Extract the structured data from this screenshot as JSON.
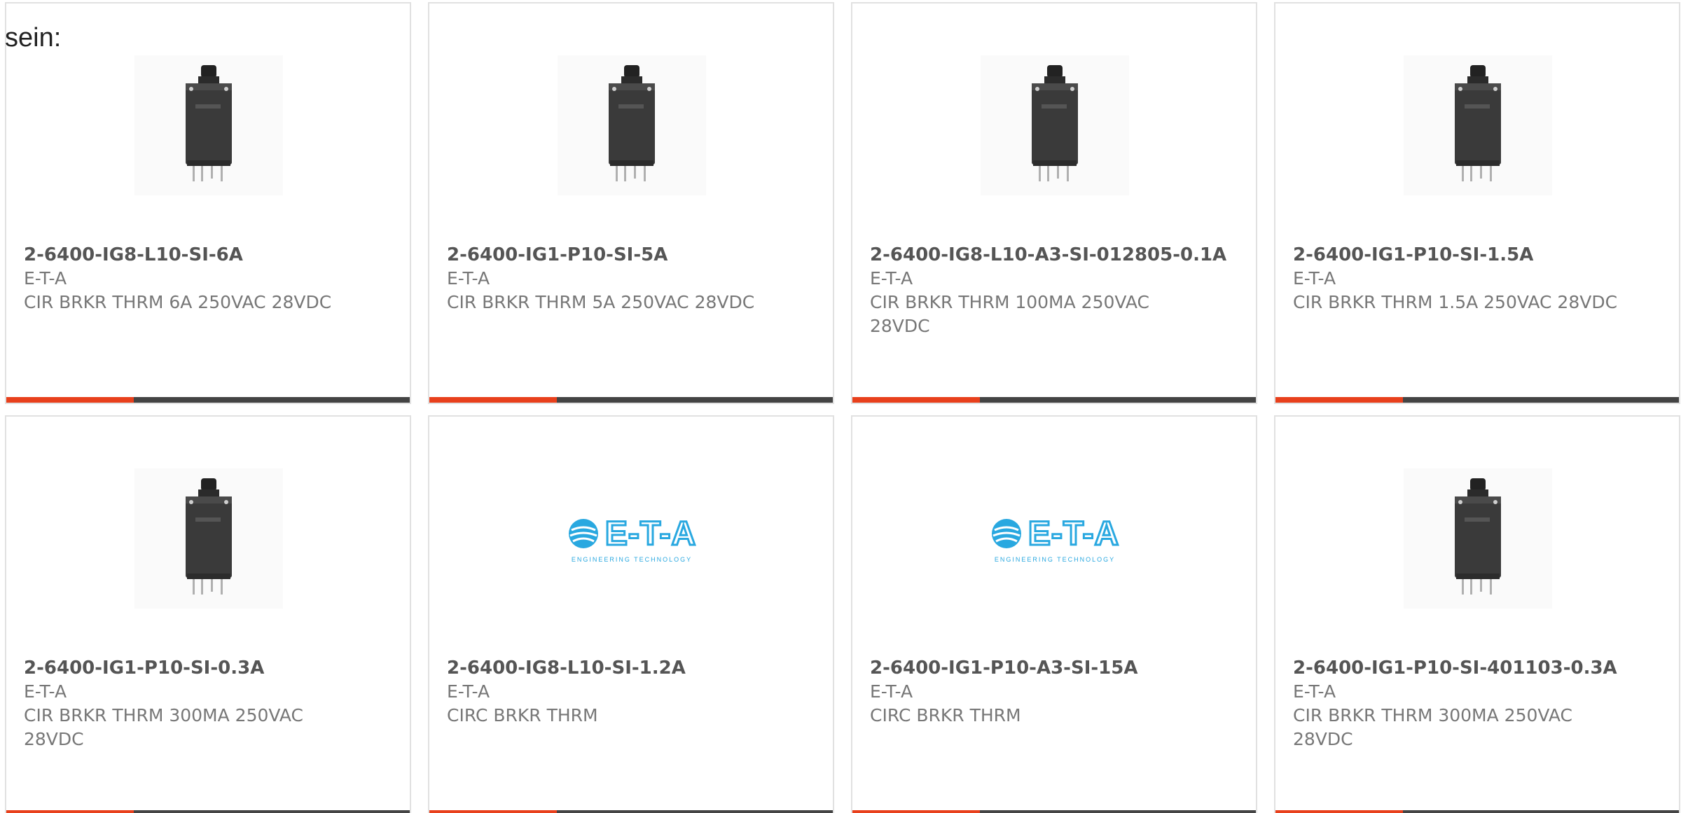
{
  "intro_text": "sein:",
  "colors": {
    "accent": "#e8401c",
    "bar_dark": "#444444",
    "logo_blue": "#29a8e0"
  },
  "cards": [
    {
      "part_number": "2-6400-IG8-L10-SI-6A",
      "manufacturer": "E-T-A",
      "description": "CIR BRKR THRM 6A 250VAC 28VDC",
      "image": "circuit-breaker-photo"
    },
    {
      "part_number": "2-6400-IG1-P10-SI-5A",
      "manufacturer": "E-T-A",
      "description": "CIR BRKR THRM 5A 250VAC 28VDC",
      "image": "circuit-breaker-photo"
    },
    {
      "part_number": "2-6400-IG8-L10-A3-SI-012805-0.1A",
      "manufacturer": "E-T-A",
      "description": "CIR BRKR THRM 100MA 250VAC 28VDC",
      "image": "circuit-breaker-photo"
    },
    {
      "part_number": "2-6400-IG1-P10-SI-1.5A",
      "manufacturer": "E-T-A",
      "description": "CIR BRKR THRM 1.5A 250VAC 28VDC",
      "image": "circuit-breaker-photo"
    },
    {
      "part_number": "2-6400-IG1-P10-SI-0.3A",
      "manufacturer": "E-T-A",
      "description": "CIR BRKR THRM 300MA 250VAC 28VDC",
      "image": "circuit-breaker-photo"
    },
    {
      "part_number": "2-6400-IG8-L10-SI-1.2A",
      "manufacturer": "E-T-A",
      "description": "CIRC BRKR THRM",
      "image": "eta-logo",
      "logo": {
        "text": "E-T-A",
        "tagline": "ENGINEERING TECHNOLOGY"
      }
    },
    {
      "part_number": "2-6400-IG1-P10-A3-SI-15A",
      "manufacturer": "E-T-A",
      "description": "CIRC BRKR THRM",
      "image": "eta-logo",
      "logo": {
        "text": "E-T-A",
        "tagline": "ENGINEERING TECHNOLOGY"
      }
    },
    {
      "part_number": "2-6400-IG1-P10-SI-401103-0.3A",
      "manufacturer": "E-T-A",
      "description": "CIR BRKR THRM 300MA 250VAC 28VDC",
      "image": "circuit-breaker-photo"
    }
  ]
}
